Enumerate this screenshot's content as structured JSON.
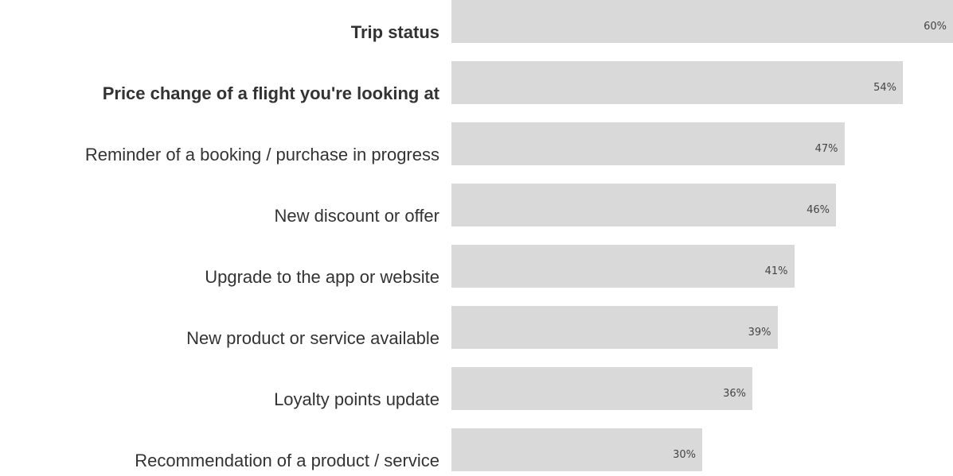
{
  "chart_data": {
    "type": "bar",
    "orientation": "horizontal",
    "categories": [
      "Trip status",
      "Price change of a flight you're looking at",
      "Reminder of a booking / purchase in progress",
      "New discount or offer",
      "Upgrade to the app or website",
      "New product or service available",
      "Loyalty points update",
      "Recommendation of a product / service"
    ],
    "values": [
      60,
      54,
      47,
      46,
      41,
      39,
      36,
      30
    ],
    "value_labels": [
      "60%",
      "54%",
      "47%",
      "46%",
      "41%",
      "39%",
      "36%",
      "30%"
    ],
    "bold_categories": [
      "Trip status",
      "Price change of a flight you're looking at"
    ],
    "unit": "%",
    "xlim": [
      0,
      60
    ],
    "grid": false,
    "bar_color": "#d9d9d9",
    "label_color": "#333333"
  }
}
